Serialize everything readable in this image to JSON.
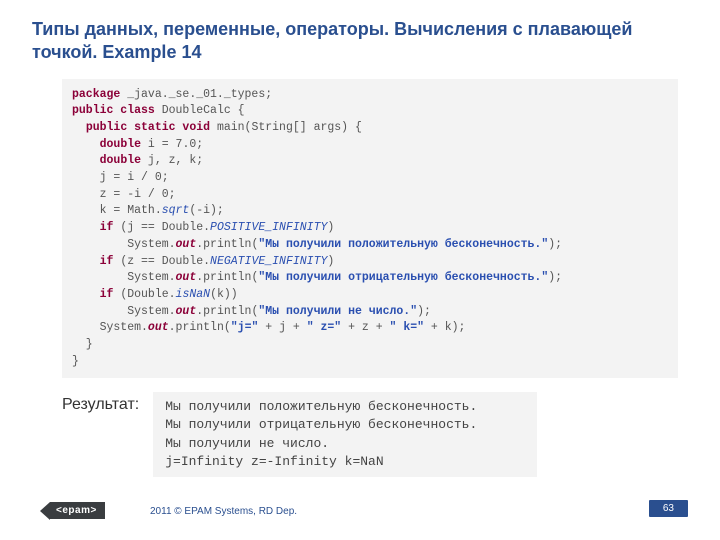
{
  "title": "Типы данных, переменные, операторы. Вычисления с плавающей точкой. Example 14",
  "code": {
    "l1": {
      "kw": "package",
      "rest": " _java._se._01._types;"
    },
    "l2": {
      "kw": "public class",
      "rest": " DoubleCalc {"
    },
    "l3": {
      "lead": "  ",
      "kw": "public static void",
      "rest": " main(String[] args) {"
    },
    "l4": {
      "lead": "    ",
      "kw": "double",
      "rest": " i = 7.0;"
    },
    "l5": {
      "lead": "    ",
      "kw": "double",
      "rest": " j, z, k;"
    },
    "l6": "    j = i / 0;",
    "l7": "    z = -i / 0;",
    "l8": {
      "a": "    k = Math.",
      "b": "sqrt",
      "c": "(-i);"
    },
    "l9": {
      "a": "    ",
      "kw": "if",
      "b": " (j == Double.",
      "c": "POSITIVE_INFINITY",
      "d": ")"
    },
    "l10": {
      "a": "        System.",
      "b": "out",
      "c": ".println(",
      "s": "\"Мы получили положительную бесконечность.\"",
      "d": ");"
    },
    "l11": {
      "a": "    ",
      "kw": "if",
      "b": " (z == Double.",
      "c": "NEGATIVE_INFINITY",
      "d": ")"
    },
    "l12": {
      "a": "        System.",
      "b": "out",
      "c": ".println(",
      "s": "\"Мы получили отрицательную бесконечность.\"",
      "d": ");"
    },
    "l13": {
      "a": "    ",
      "kw": "if",
      "b": " (Double.",
      "c": "isNaN",
      "d": "(k))"
    },
    "l14": {
      "a": "        System.",
      "b": "out",
      "c": ".println(",
      "s": "\"Мы получили не число.\"",
      "d": ");"
    },
    "l15": {
      "a": "    System.",
      "b": "out",
      "c": ".println(",
      "s1": "\"j=\"",
      "p1": " + j + ",
      "s2": "\" z=\"",
      "p2": " + z + ",
      "s3": "\" k=\"",
      "p3": " + k);"
    },
    "l16": "  }",
    "l17": "}"
  },
  "result_label": "Результат:",
  "result": "Мы получили положительную бесконечность.\nМы получили отрицательную бесконечность.\nМы получили не число.\nj=Infinity z=-Infinity k=NaN",
  "footer": {
    "logo": "<epam>",
    "copyright": "2011 © EPAM Systems, RD Dep.",
    "page": "63"
  }
}
